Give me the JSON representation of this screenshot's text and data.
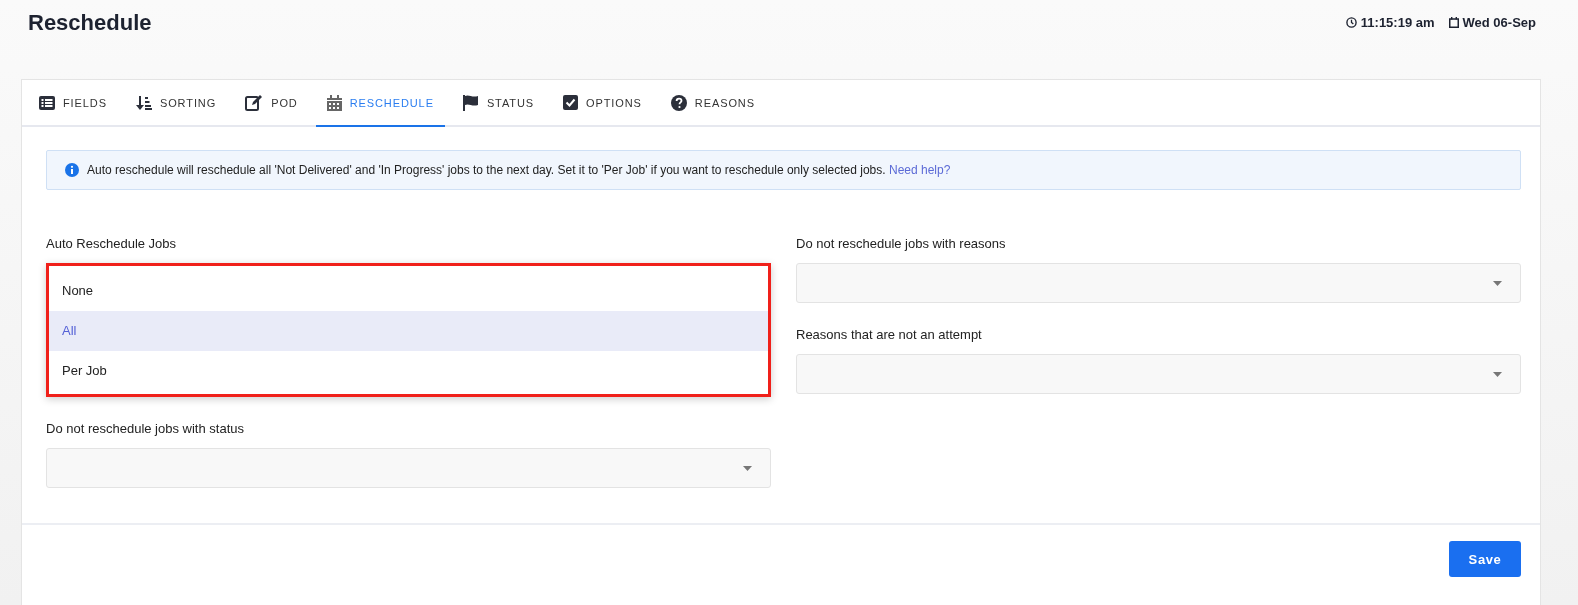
{
  "header": {
    "title": "Reschedule",
    "time": "11:15:19 am",
    "date": "Wed 06-Sep"
  },
  "tabs": [
    {
      "label": "FIELDS",
      "kind": "list",
      "selected": false
    },
    {
      "label": "SORTING",
      "kind": "sort",
      "selected": false
    },
    {
      "label": "POD",
      "kind": "edit",
      "selected": false
    },
    {
      "label": "RESCHEDULE",
      "kind": "calendar",
      "selected": true
    },
    {
      "label": "STATUS",
      "kind": "flag",
      "selected": false
    },
    {
      "label": "OPTIONS",
      "kind": "check",
      "selected": false
    },
    {
      "label": "REASONS",
      "kind": "question",
      "selected": false
    }
  ],
  "info": {
    "text": "Auto reschedule will reschedule all 'Not Delivered' and 'In Progress' jobs to the next day. Set it to 'Per Job' if you want to reschedule only selected jobs.",
    "link": "Need help?"
  },
  "left_fields": [
    {
      "kind": "menu",
      "label": "Auto Reschedule Jobs",
      "highlighted": true,
      "options": [
        {
          "label": "None",
          "selected": false
        },
        {
          "label": "All",
          "selected": true
        },
        {
          "label": "Per Job",
          "selected": false
        }
      ]
    },
    {
      "kind": "select",
      "label": "Do not reschedule jobs with status"
    }
  ],
  "right_fields": [
    {
      "kind": "select",
      "label": "Do not reschedule jobs with reasons"
    },
    {
      "kind": "select",
      "label": "Reasons that are not an attempt"
    }
  ],
  "save_button": "Save"
}
